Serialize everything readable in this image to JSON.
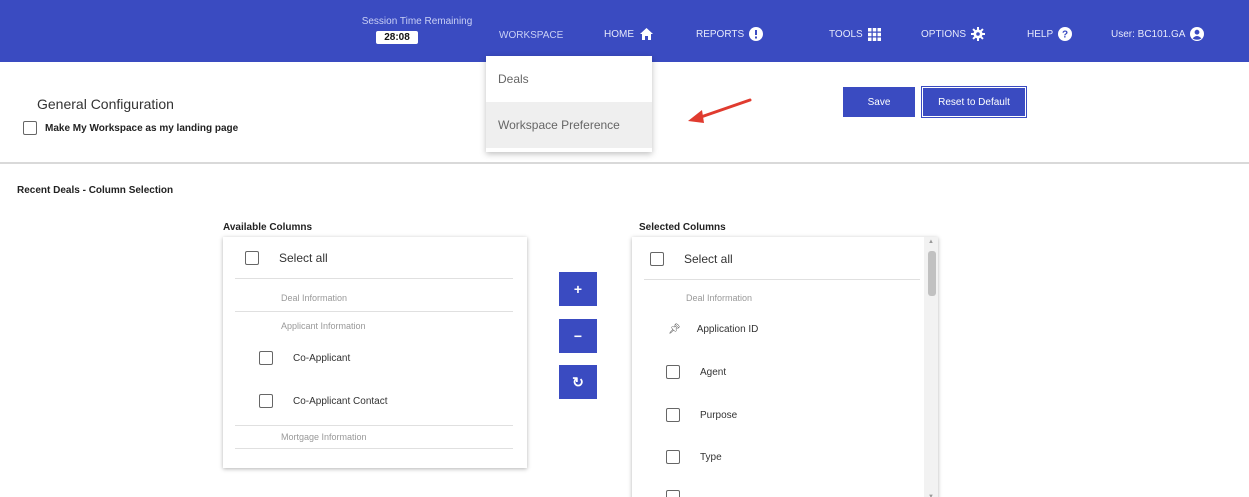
{
  "header": {
    "session_label": "Session Time Remaining",
    "session_time": "28:08",
    "nav": {
      "workspace": "WORKSPACE",
      "home": "HOME",
      "reports": "REPORTS",
      "tools": "TOOLS",
      "options": "OPTIONS",
      "help": "HELP",
      "user": "User: BC101.GA"
    },
    "icons": {
      "home": "home-icon",
      "reports": "info-icon",
      "tools": "grid-icon",
      "options": "gear-icon",
      "help": "help-icon",
      "user": "user-circle-icon"
    },
    "colors": {
      "bar": "#3a4bc1",
      "arrow": "#e03b2f"
    }
  },
  "dropdown": {
    "items": [
      "Deals",
      "Workspace Preference"
    ],
    "selected": "Workspace Preference"
  },
  "general": {
    "title": "General Configuration",
    "landing_label": "Make My Workspace as my landing page",
    "landing_checked": false
  },
  "actions": {
    "save": "Save",
    "reset": "Reset to Default"
  },
  "recent": {
    "title": "Recent Deals - Column Selection",
    "available": {
      "title": "Available Columns",
      "select_all": "Select all",
      "groups": [
        "Deal Information",
        "Applicant Information",
        "Mortgage Information"
      ],
      "items": [
        "Co-Applicant",
        "Co-Applicant Contact"
      ]
    },
    "selected": {
      "title": "Selected Columns",
      "select_all": "Select all",
      "group": "Deal Information",
      "pinned": "Application ID",
      "items": [
        "Agent",
        "Purpose",
        "Type"
      ]
    },
    "buttons": {
      "add": "+",
      "remove": "−",
      "refresh": "↻"
    }
  }
}
